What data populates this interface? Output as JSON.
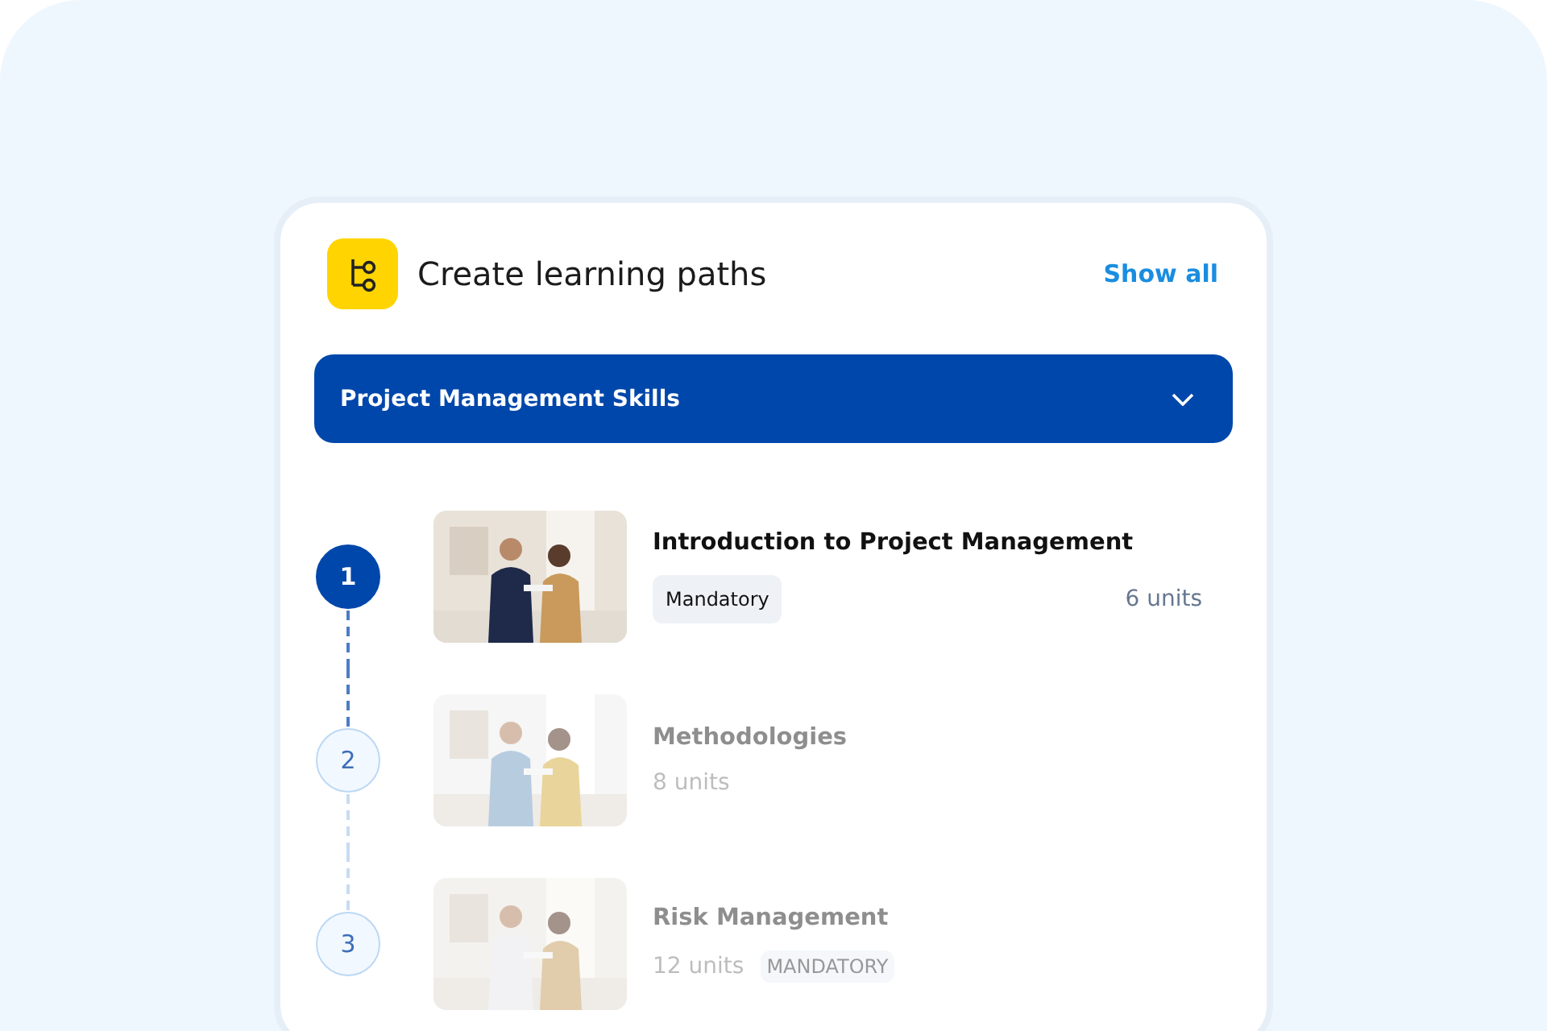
{
  "card": {
    "title": "Create learning paths",
    "link": "Show all"
  },
  "path_select": {
    "value": "Project Management Skills"
  },
  "steps": [
    {
      "number": "1",
      "selected": true,
      "kind": "tag-first",
      "title": "Introduction to Project Management",
      "tag": "Mandatory",
      "units": "6 units"
    },
    {
      "number": "2",
      "selected": false,
      "kind": "units-first",
      "title": "Methodologies",
      "units": "8 units"
    },
    {
      "number": "3",
      "selected": false,
      "kind": "units-first",
      "title": "Risk Management",
      "units": "12 units",
      "tag": "MANDATORY"
    }
  ]
}
